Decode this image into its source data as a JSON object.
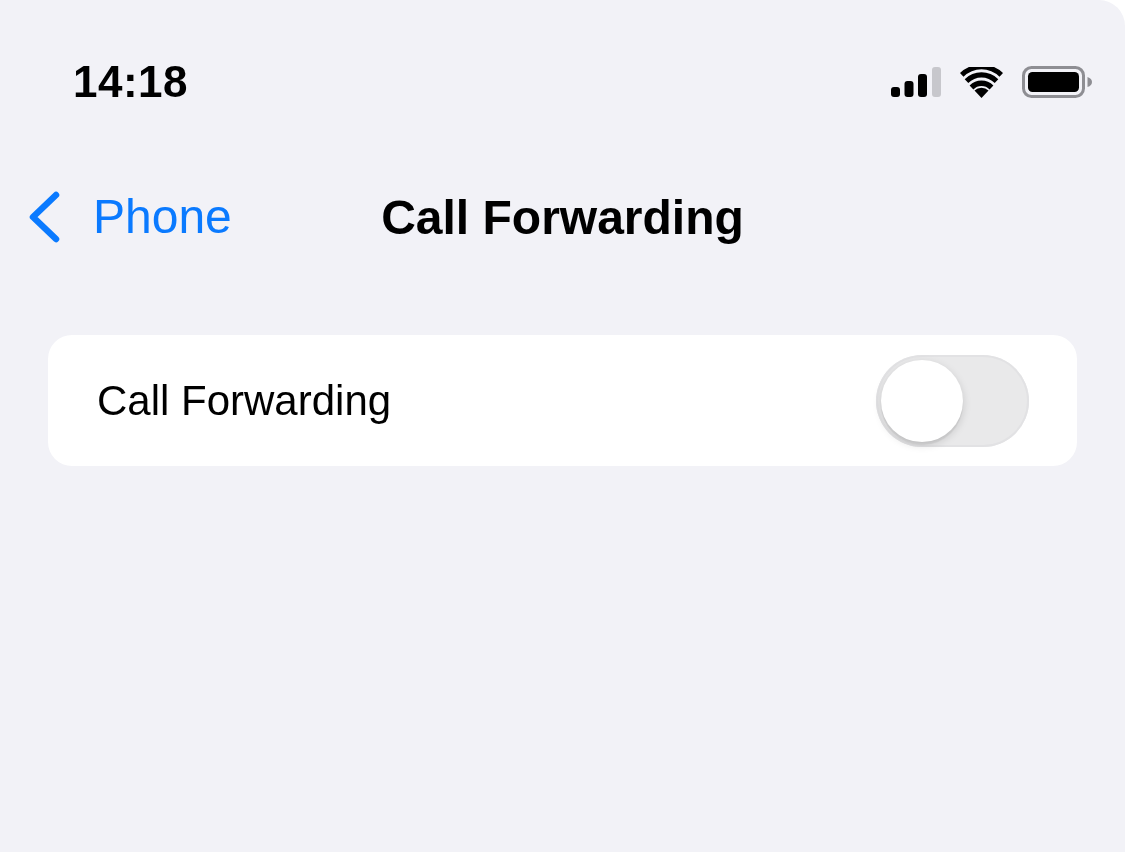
{
  "status_bar": {
    "time": "14:18"
  },
  "nav_bar": {
    "back_label": "Phone",
    "title": "Call Forwarding"
  },
  "settings": [
    {
      "kind": "toggle",
      "label": "Call Forwarding",
      "on": false
    }
  ]
}
